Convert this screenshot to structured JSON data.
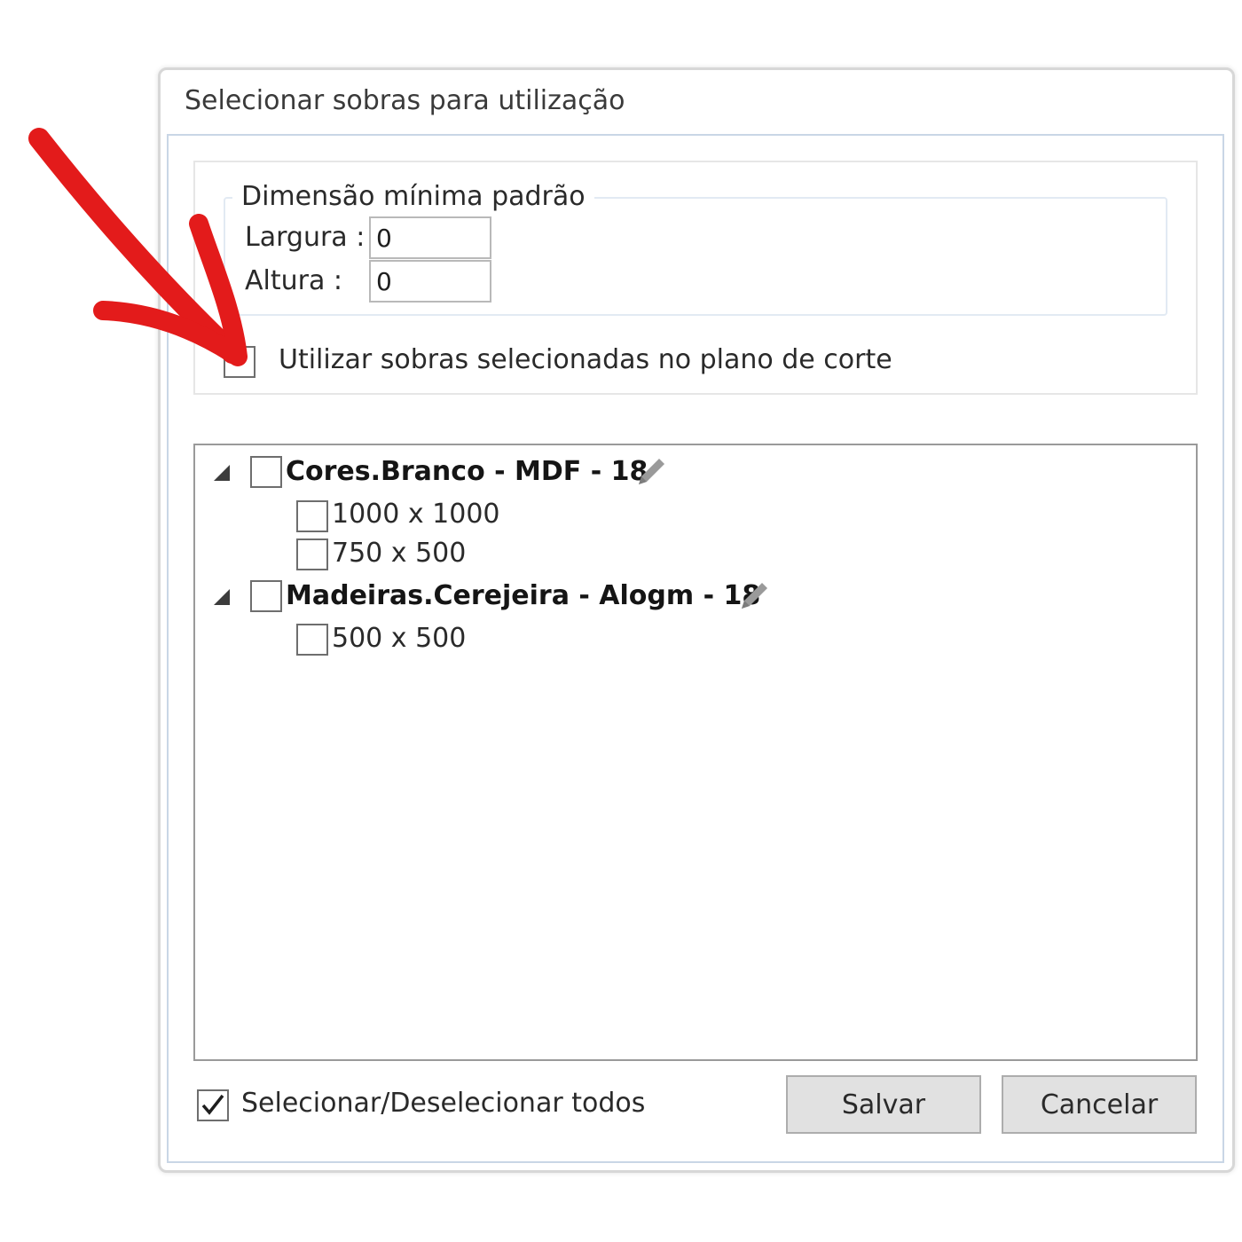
{
  "dialog": {
    "title": "Selecionar sobras para utilização"
  },
  "min_dimension": {
    "legend": "Dimensão mínima padrão",
    "width_label": "Largura :",
    "width_value": "0",
    "height_label": "Altura :",
    "height_value": "0"
  },
  "use_selected": {
    "label": "Utilizar sobras selecionadas no plano de corte",
    "checked": false
  },
  "tree": {
    "groups": [
      {
        "label": "Cores.Branco - MDF - 18",
        "checked": false,
        "expanded": true,
        "items": [
          {
            "label": "1000 x 1000",
            "checked": false
          },
          {
            "label": "750 x 500",
            "checked": false
          }
        ]
      },
      {
        "label": "Madeiras.Cerejeira - Alogm - 18",
        "checked": false,
        "expanded": true,
        "items": [
          {
            "label": "500 x 500",
            "checked": false
          }
        ]
      }
    ]
  },
  "footer": {
    "select_all_label": "Selecionar/Deselecionar todos",
    "select_all_checked": true,
    "save_label": "Salvar",
    "cancel_label": "Cancelar"
  },
  "annotation": {
    "arrow_color": "#e31b1b"
  },
  "icons": {
    "edit": "pencil-icon",
    "expander": "expanded-triangle-icon",
    "check": "checkmark-icon"
  }
}
